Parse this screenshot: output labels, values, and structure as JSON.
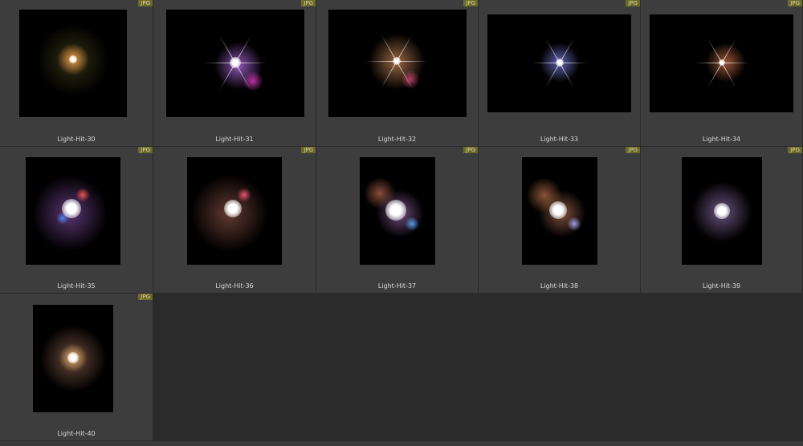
{
  "badge_label": "JPG",
  "items": [
    {
      "name": "Light-Hit-30"
    },
    {
      "name": "Light-Hit-31"
    },
    {
      "name": "Light-Hit-32"
    },
    {
      "name": "Light-Hit-33"
    },
    {
      "name": "Light-Hit-34"
    },
    {
      "name": "Light-Hit-35"
    },
    {
      "name": "Light-Hit-36"
    },
    {
      "name": "Light-Hit-37"
    },
    {
      "name": "Light-Hit-38"
    },
    {
      "name": "Light-Hit-39"
    },
    {
      "name": "Light-Hit-40"
    }
  ]
}
